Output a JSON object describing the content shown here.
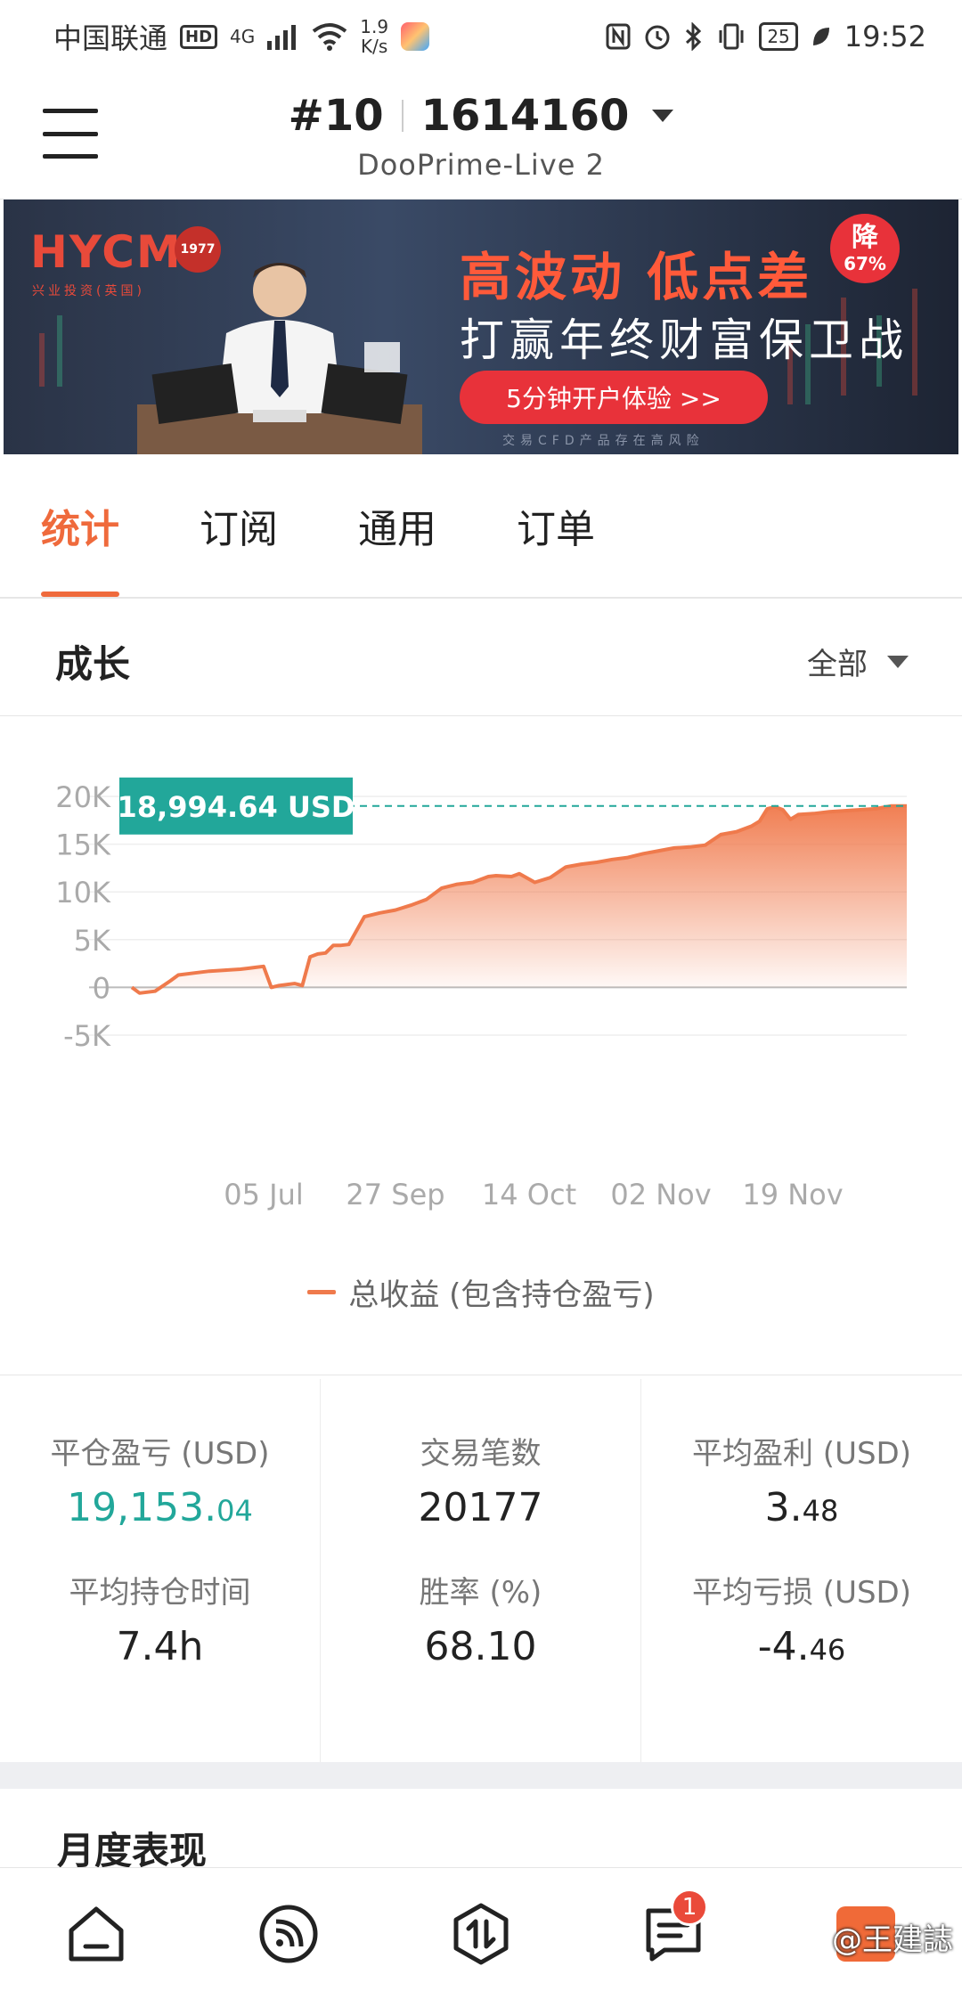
{
  "status_bar": {
    "carrier": "中国联通",
    "hd": "HD",
    "network": "4G",
    "speed_value": "1.9",
    "speed_unit": "K/s",
    "battery": "25",
    "time": "19:52"
  },
  "header": {
    "account_no": "#10",
    "account_id": "1614160",
    "server": "DooPrime-Live 2"
  },
  "banner": {
    "logo": "HYCM",
    "logo_sub": "兴业投资(英国)",
    "seal": "1977",
    "headline": "高波动 低点差",
    "subheadline": "打赢年终财富保卫战",
    "badge_top": "降",
    "badge_bottom": "67%",
    "cta": "5分钟开户体验 >>",
    "risk_note": "交易CFD产品存在高风险"
  },
  "tabs": [
    {
      "label": "统计",
      "active": true
    },
    {
      "label": "订阅",
      "active": false
    },
    {
      "label": "通用",
      "active": false
    },
    {
      "label": "订单",
      "active": false
    }
  ],
  "section": {
    "title": "成长",
    "filter": "全部"
  },
  "chart_data": {
    "type": "area",
    "current_label": "18,994.64 USD",
    "current_value": 18994.64,
    "ylim": [
      -5000,
      20000
    ],
    "yticks": [
      20000,
      15000,
      10000,
      5000,
      0,
      -5000
    ],
    "ytick_labels": [
      "20K",
      "15K",
      "10K",
      "5K",
      "0",
      "-5K"
    ],
    "xtick_labels": [
      "05 Jul",
      "27 Sep",
      "14 Oct",
      "02 Nov",
      "19 Nov"
    ],
    "series": [
      {
        "name": "总收益 (包含持仓盈亏)",
        "color": "#ef7a4c",
        "x": [
          0,
          0.01,
          0.03,
          0.05,
          0.06,
          0.08,
          0.1,
          0.12,
          0.14,
          0.15,
          0.16,
          0.17,
          0.18,
          0.19,
          0.2,
          0.21,
          0.22,
          0.23,
          0.24,
          0.25,
          0.26,
          0.27,
          0.28,
          0.3,
          0.32,
          0.34,
          0.36,
          0.38,
          0.39,
          0.4,
          0.42,
          0.44,
          0.46,
          0.47,
          0.49,
          0.5,
          0.52,
          0.54,
          0.56,
          0.58,
          0.6,
          0.62,
          0.64,
          0.66,
          0.68,
          0.7,
          0.72,
          0.74,
          0.76,
          0.78,
          0.8,
          0.81,
          0.82,
          0.83,
          0.84,
          0.85,
          0.86,
          0.88,
          0.9,
          0.92,
          0.94,
          0.96,
          0.98,
          1.0
        ],
        "values": [
          0,
          -600,
          -400,
          700,
          1300,
          1500,
          1700,
          1800,
          1900,
          2000,
          2100,
          2200,
          0,
          200,
          300,
          400,
          200,
          3200,
          3500,
          3600,
          4400,
          4400,
          4500,
          7400,
          7800,
          8100,
          8600,
          9200,
          9800,
          10400,
          10800,
          11000,
          11600,
          11700,
          11600,
          11900,
          11000,
          11500,
          12600,
          12900,
          13100,
          13400,
          13600,
          14000,
          14300,
          14600,
          14700,
          14900,
          16000,
          16300,
          16900,
          17400,
          18700,
          18900,
          18600,
          17600,
          18100,
          18200,
          18400,
          18500,
          18600,
          18700,
          19000,
          18994.64
        ]
      }
    ],
    "legend": "总收益 (包含持仓盈亏)",
    "grid": true
  },
  "stats": {
    "closed_pnl_label": "平仓盈亏 (USD)",
    "closed_pnl_int": "19,153.",
    "closed_pnl_dec": "04",
    "trades_label": "交易笔数",
    "trades_value": "20177",
    "avg_profit_label": "平均盈利 (USD)",
    "avg_profit_int": "3.",
    "avg_profit_dec": "48",
    "avg_hold_label": "平均持仓时间",
    "avg_hold_value": "7.4h",
    "win_rate_label": "胜率 (%)",
    "win_rate_value": "68.10",
    "avg_loss_label": "平均亏损 (USD)",
    "avg_loss_int": "-4.",
    "avg_loss_dec": "46"
  },
  "monthly": {
    "title": "月度表现"
  },
  "bottom_nav": {
    "message_badge": "1",
    "watermark": "@王建誌",
    "icons": [
      "home-icon",
      "feed-icon",
      "trade-icon",
      "message-icon",
      "profile-icon"
    ]
  }
}
